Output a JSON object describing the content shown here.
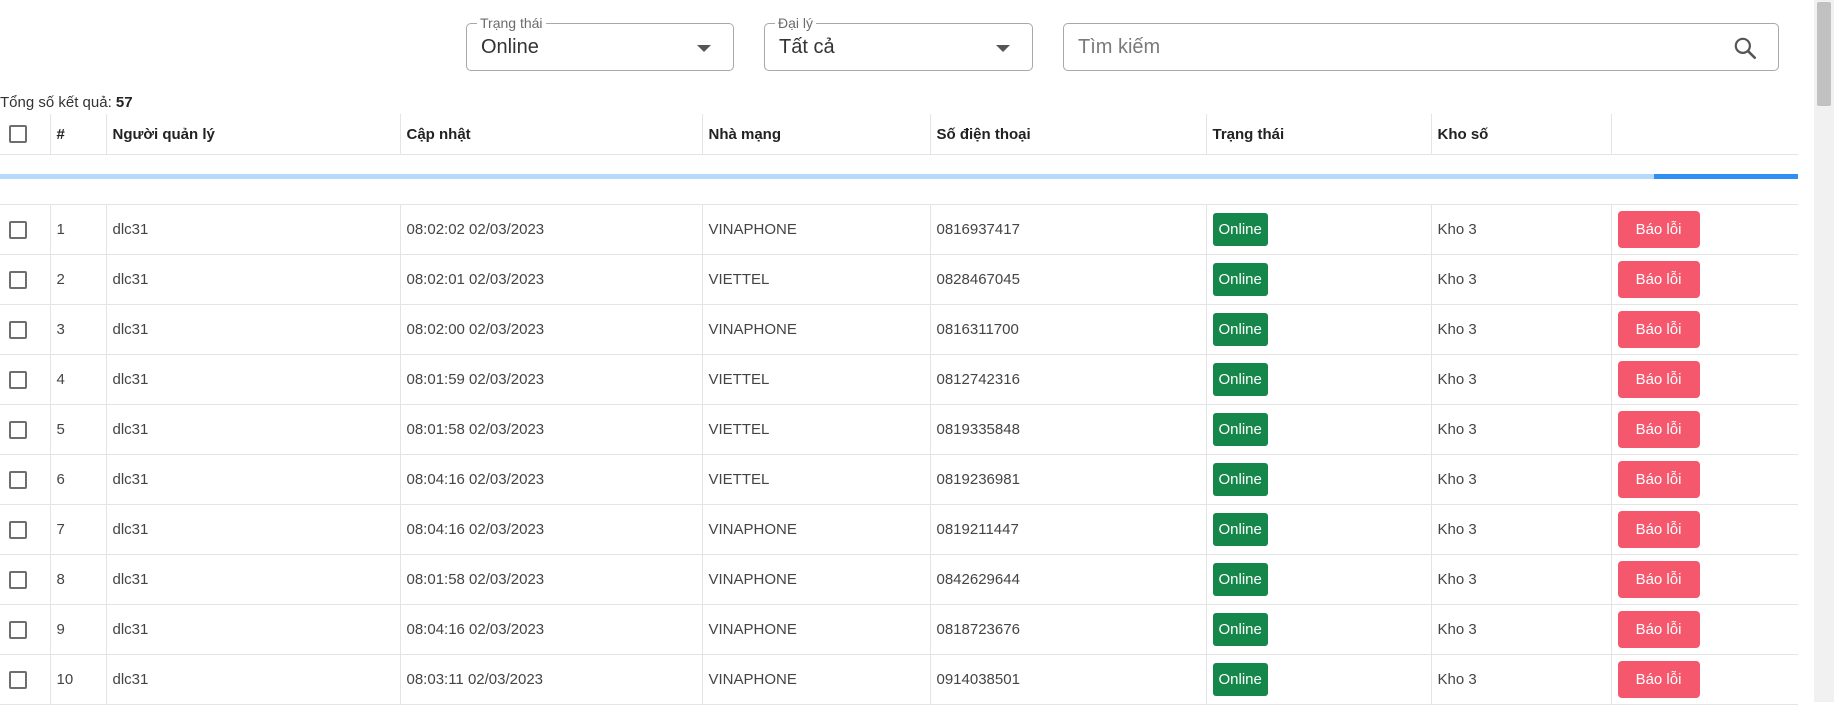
{
  "filters": {
    "status": {
      "label": "Trạng thái",
      "value": "Online"
    },
    "agent": {
      "label": "Đại lý",
      "value": "Tất cả"
    },
    "search": {
      "placeholder": "Tìm kiếm"
    }
  },
  "summary": {
    "label": "Tổng số kết quả:",
    "count": "57"
  },
  "table": {
    "headers": {
      "number": "#",
      "manager": "Người quản lý",
      "updated": "Cập nhật",
      "carrier": "Nhà mạng",
      "phone": "Số điện thoại",
      "status": "Trạng thái",
      "store": "Kho số",
      "action": ""
    },
    "loading_progress": 0.08,
    "rows": [
      {
        "num": "1",
        "manager": "dlc31",
        "updated": "08:02:02 02/03/2023",
        "carrier": "VINAPHONE",
        "phone": "0816937417",
        "status": "Online",
        "store": "Kho 3",
        "action": "Báo lỗi"
      },
      {
        "num": "2",
        "manager": "dlc31",
        "updated": "08:02:01 02/03/2023",
        "carrier": "VIETTEL",
        "phone": "0828467045",
        "status": "Online",
        "store": "Kho 3",
        "action": "Báo lỗi"
      },
      {
        "num": "3",
        "manager": "dlc31",
        "updated": "08:02:00 02/03/2023",
        "carrier": "VINAPHONE",
        "phone": "0816311700",
        "status": "Online",
        "store": "Kho 3",
        "action": "Báo lỗi"
      },
      {
        "num": "4",
        "manager": "dlc31",
        "updated": "08:01:59 02/03/2023",
        "carrier": "VIETTEL",
        "phone": "0812742316",
        "status": "Online",
        "store": "Kho 3",
        "action": "Báo lỗi"
      },
      {
        "num": "5",
        "manager": "dlc31",
        "updated": "08:01:58 02/03/2023",
        "carrier": "VIETTEL",
        "phone": "0819335848",
        "status": "Online",
        "store": "Kho 3",
        "action": "Báo lỗi"
      },
      {
        "num": "6",
        "manager": "dlc31",
        "updated": "08:04:16 02/03/2023",
        "carrier": "VIETTEL",
        "phone": "0819236981",
        "status": "Online",
        "store": "Kho 3",
        "action": "Báo lỗi"
      },
      {
        "num": "7",
        "manager": "dlc31",
        "updated": "08:04:16 02/03/2023",
        "carrier": "VINAPHONE",
        "phone": "0819211447",
        "status": "Online",
        "store": "Kho 3",
        "action": "Báo lỗi"
      },
      {
        "num": "8",
        "manager": "dlc31",
        "updated": "08:01:58 02/03/2023",
        "carrier": "VINAPHONE",
        "phone": "0842629644",
        "status": "Online",
        "store": "Kho 3",
        "action": "Báo lỗi"
      },
      {
        "num": "9",
        "manager": "dlc31",
        "updated": "08:04:16 02/03/2023",
        "carrier": "VINAPHONE",
        "phone": "0818723676",
        "status": "Online",
        "store": "Kho 3",
        "action": "Báo lỗi"
      },
      {
        "num": "10",
        "manager": "dlc31",
        "updated": "08:03:11 02/03/2023",
        "carrier": "VINAPHONE",
        "phone": "0914038501",
        "status": "Online",
        "store": "Kho 3",
        "action": "Báo lỗi"
      }
    ]
  },
  "colors": {
    "online": "#15874a",
    "report": "#f5576c",
    "progress": "#2f8ff2",
    "progress_track": "#b6dafb"
  },
  "icons": {
    "search": "search-icon",
    "dropdown": "chevron-down-icon",
    "checkbox": "checkbox-icon"
  }
}
